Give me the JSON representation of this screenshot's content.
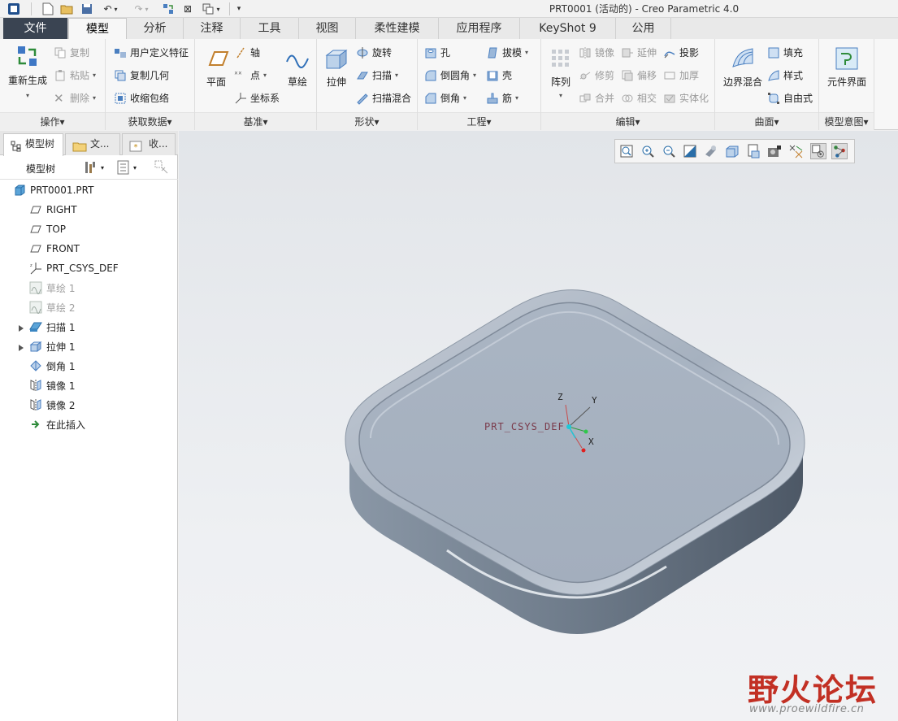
{
  "window": {
    "title": "PRT0001 (活动的) - Creo Parametric 4.0"
  },
  "tabs": [
    {
      "label": "文件"
    },
    {
      "label": "模型"
    },
    {
      "label": "分析"
    },
    {
      "label": "注释"
    },
    {
      "label": "工具"
    },
    {
      "label": "视图"
    },
    {
      "label": "柔性建模"
    },
    {
      "label": "应用程序"
    },
    {
      "label": "KeyShot 9"
    },
    {
      "label": "公用"
    }
  ],
  "ribbon": {
    "operations": {
      "label": "操作▾",
      "regenerate": "重新生成",
      "copy": "复制",
      "paste": "粘贴",
      "delete": "删除"
    },
    "get_data": {
      "label": "获取数据▾",
      "udf": "用户定义特征",
      "copy_geom": "复制几何",
      "shrinkwrap": "收缩包络"
    },
    "datum": {
      "label": "基准▾",
      "plane": "平面",
      "axis": "轴",
      "point": "点",
      "csys": "坐标系",
      "sketch": "草绘"
    },
    "shapes": {
      "label": "形状▾",
      "extrude": "拉伸",
      "revolve": "旋转",
      "sweep": "扫描",
      "swept_blend": "扫描混合"
    },
    "engineering": {
      "label": "工程▾",
      "hole": "孔",
      "round": "倒圆角",
      "chamfer": "倒角",
      "draft": "拔模",
      "shell": "壳",
      "rib": "筋"
    },
    "editing": {
      "label": "编辑▾",
      "pattern": "阵列",
      "mirror": "镜像",
      "trim": "修剪",
      "merge": "合并",
      "extend": "延伸",
      "offset": "偏移",
      "intersect": "相交",
      "project": "投影",
      "thicken": "加厚",
      "solidify": "实体化"
    },
    "surfaces": {
      "label": "曲面▾",
      "boundary_blend": "边界混合",
      "fill": "填充",
      "style": "样式",
      "freestyle": "自由式"
    },
    "model_intent": {
      "label": "模型意图▾",
      "component_interface": "元件界面"
    }
  },
  "panel": {
    "tabs": [
      {
        "label": "模型树"
      },
      {
        "label": "文..."
      },
      {
        "label": "收..."
      }
    ],
    "tree_title": "模型树"
  },
  "tree": [
    {
      "label": "PRT0001.PRT",
      "icon": "part-icon"
    },
    {
      "label": "RIGHT",
      "icon": "datum-plane-icon"
    },
    {
      "label": "TOP",
      "icon": "datum-plane-icon"
    },
    {
      "label": "FRONT",
      "icon": "datum-plane-icon"
    },
    {
      "label": "PRT_CSYS_DEF",
      "icon": "csys-icon"
    },
    {
      "label": "草绘 1",
      "icon": "sketch-icon"
    },
    {
      "label": "草绘 2",
      "icon": "sketch-icon"
    },
    {
      "label": "扫描 1",
      "icon": "sweep-icon"
    },
    {
      "label": "拉伸 1",
      "icon": "extrude-icon"
    },
    {
      "label": "倒角 1",
      "icon": "chamfer-icon"
    },
    {
      "label": "镜像 1",
      "icon": "mirror-icon"
    },
    {
      "label": "镜像 2",
      "icon": "mirror-icon"
    },
    {
      "label": "在此插入",
      "icon": "insert-here-icon"
    }
  ],
  "viewport": {
    "csys_label": "PRT_CSYS_DEF",
    "axis_x": "X",
    "axis_y": "Y",
    "axis_z": "Z"
  },
  "watermark": {
    "logo_text": "野火论坛",
    "url": "www.proewildfire.cn"
  },
  "colors": {
    "file_tab": "#3a4452",
    "model_fill": "#a9b4c2",
    "watermark_red": "#c23024"
  }
}
